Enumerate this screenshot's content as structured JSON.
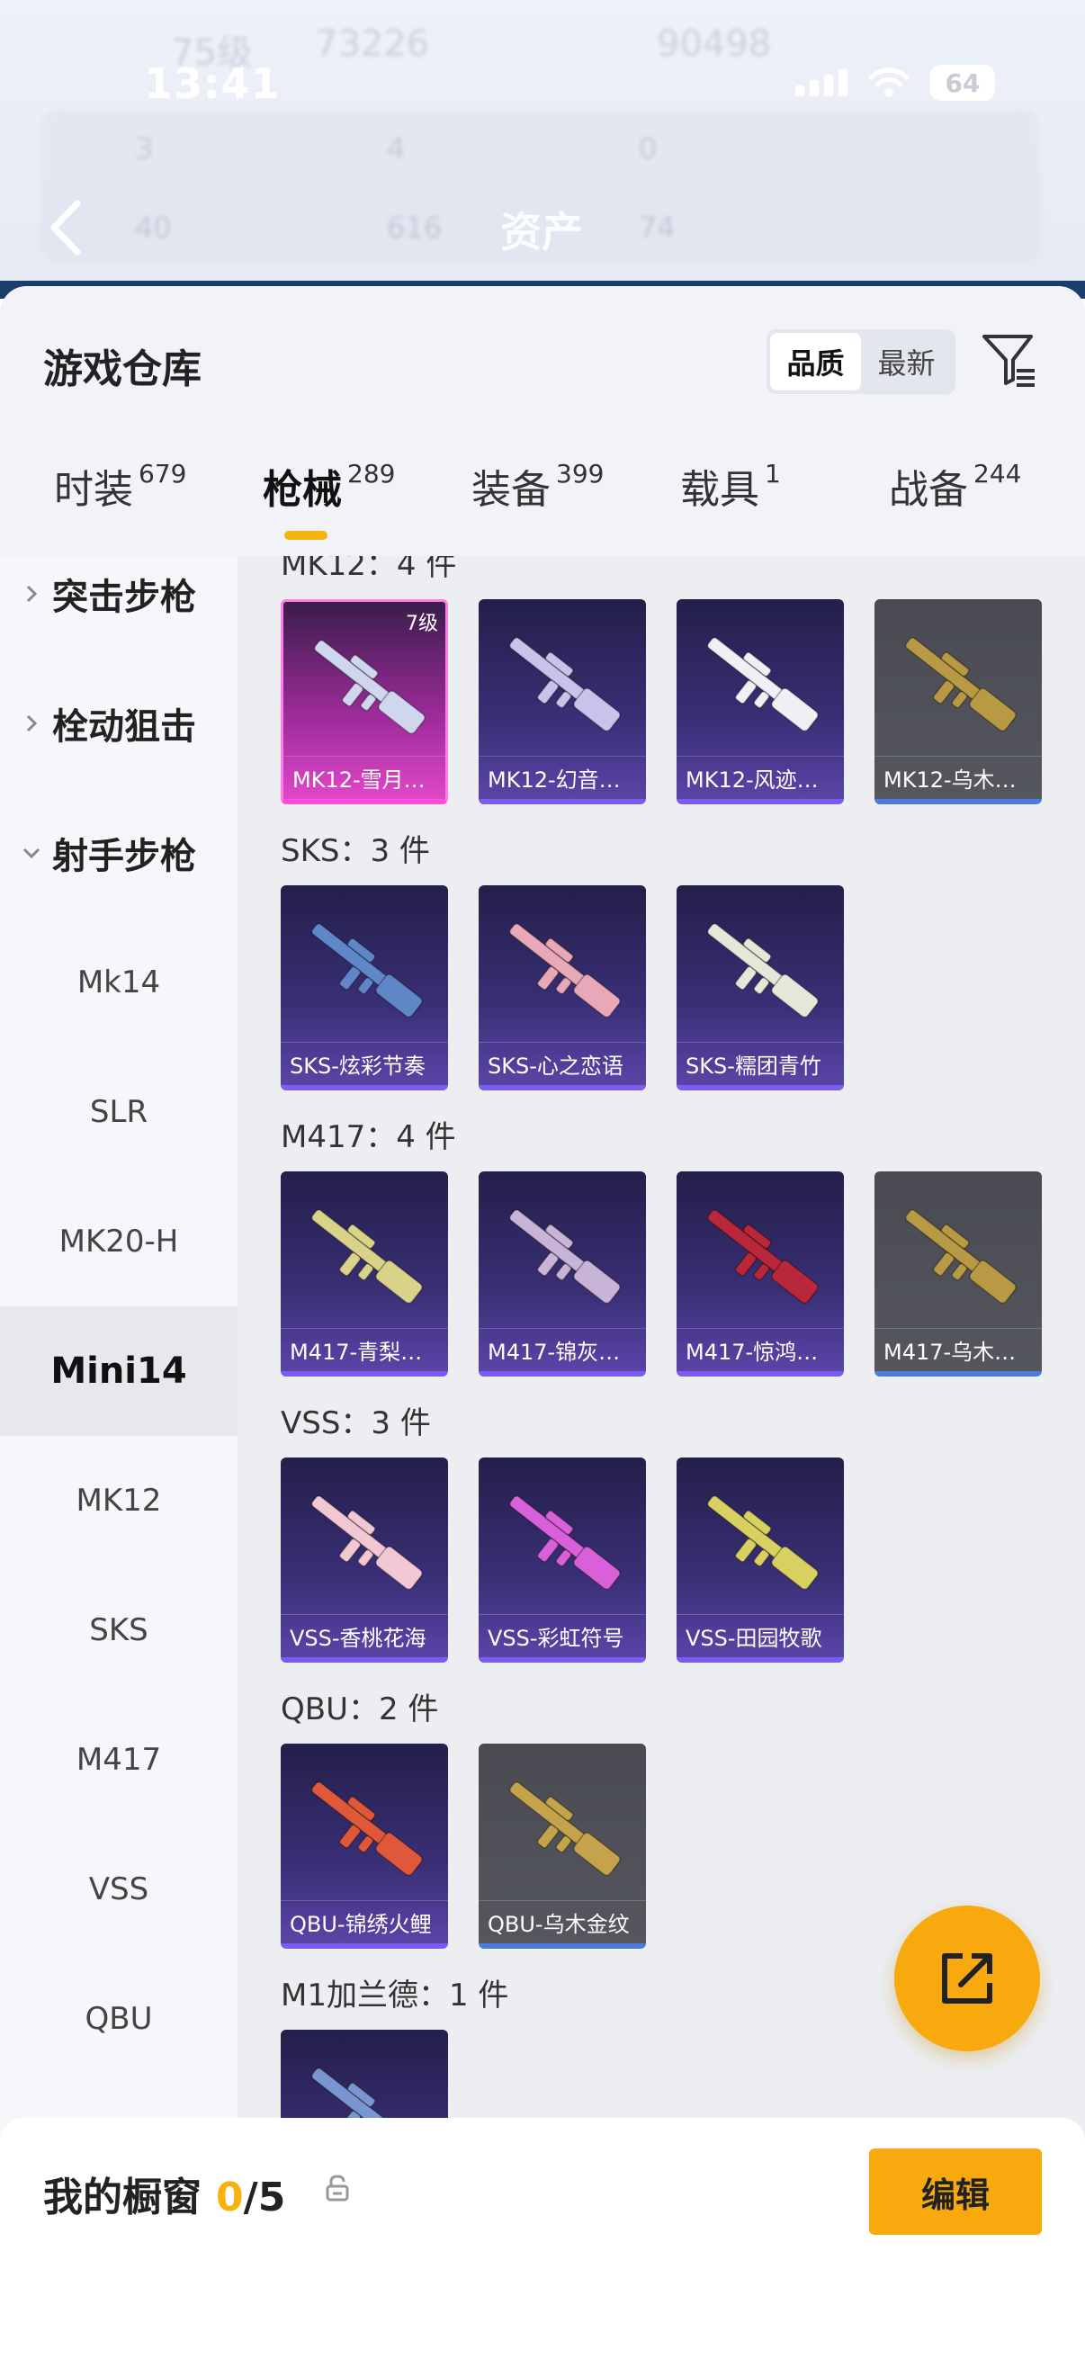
{
  "status_bar": {
    "time": "13:41",
    "battery": "64"
  },
  "header_ghost": {
    "level": "75级",
    "coins": "73226",
    "coins2": "90498",
    "s1": "3",
    "s2": "4",
    "s3": "0",
    "s4": "40",
    "s5": "616",
    "s6": "74"
  },
  "nav": {
    "title": "资产"
  },
  "panel": {
    "title": "游戏仓库",
    "sort_options": [
      "品质",
      "最新"
    ],
    "sort_active": "品质"
  },
  "tabs": [
    {
      "label": "时装",
      "count": "679"
    },
    {
      "label": "枪械",
      "count": "289"
    },
    {
      "label": "装备",
      "count": "399"
    },
    {
      "label": "载具",
      "count": "1"
    },
    {
      "label": "战备",
      "count": "244"
    }
  ],
  "sidebar": [
    {
      "label": "突击步枪",
      "type": "category",
      "expanded": false
    },
    {
      "label": "栓动狙击",
      "type": "category",
      "expanded": false
    },
    {
      "label": "射手步枪",
      "type": "category",
      "expanded": true
    },
    {
      "label": "Mk14"
    },
    {
      "label": "SLR"
    },
    {
      "label": "MK20-H"
    },
    {
      "label": "Mini14",
      "active": true
    },
    {
      "label": "MK12"
    },
    {
      "label": "SKS"
    },
    {
      "label": "M417"
    },
    {
      "label": "VSS"
    },
    {
      "label": "QBU"
    }
  ],
  "sections": [
    {
      "label": "MK12：4 件",
      "items": [
        {
          "name": "MK12-雪月…",
          "style": "pink",
          "level": "7级",
          "gun": "#cfd6ee"
        },
        {
          "name": "MK12-幻音…",
          "style": "purple",
          "gun": "#c9c2ea"
        },
        {
          "name": "MK12-风迹…",
          "style": "purple",
          "gun": "#eef0f6"
        },
        {
          "name": "MK12-乌木…",
          "style": "gray",
          "gun": "#b89a44"
        }
      ]
    },
    {
      "label": "SKS：3 件",
      "items": [
        {
          "name": "SKS-炫彩节奏",
          "style": "purple",
          "gun": "#5f86c6"
        },
        {
          "name": "SKS-心之恋语",
          "style": "purple",
          "gun": "#e8a8b8"
        },
        {
          "name": "SKS-糯团青竹",
          "style": "purple",
          "gun": "#e5e8d8"
        }
      ]
    },
    {
      "label": "M417：4 件",
      "items": [
        {
          "name": "M417-青梨…",
          "style": "purple",
          "gun": "#d9d38a"
        },
        {
          "name": "M417-锦灰…",
          "style": "purple",
          "gun": "#c8b4d6"
        },
        {
          "name": "M417-惊鸿…",
          "style": "purple",
          "gun": "#b8283a"
        },
        {
          "name": "M417-乌木…",
          "style": "gray",
          "gun": "#b89a44"
        }
      ]
    },
    {
      "label": "VSS：3 件",
      "items": [
        {
          "name": "VSS-香桃花海",
          "style": "purple",
          "gun": "#f2c7d4"
        },
        {
          "name": "VSS-彩虹符号",
          "style": "purple",
          "gun": "#d860d8"
        },
        {
          "name": "VSS-田园牧歌",
          "style": "purple",
          "gun": "#d8d060"
        }
      ]
    },
    {
      "label": "QBU：2 件",
      "items": [
        {
          "name": "QBU-锦绣火鲤",
          "style": "purple",
          "gun": "#e0583a"
        },
        {
          "name": "QBU-乌木金纹",
          "style": "gray",
          "gun": "#c4a34a"
        }
      ]
    },
    {
      "label": "M1加兰德：1 件",
      "items": [
        {
          "name": "",
          "style": "purple",
          "gun": "#7a96d0"
        }
      ]
    }
  ],
  "bottom": {
    "title": "我的橱窗",
    "current": "0",
    "separator": "/",
    "total": "5",
    "edit_label": "编辑"
  },
  "colors": {
    "accent": "#f7a90e",
    "highlight": "#f6b20f"
  }
}
